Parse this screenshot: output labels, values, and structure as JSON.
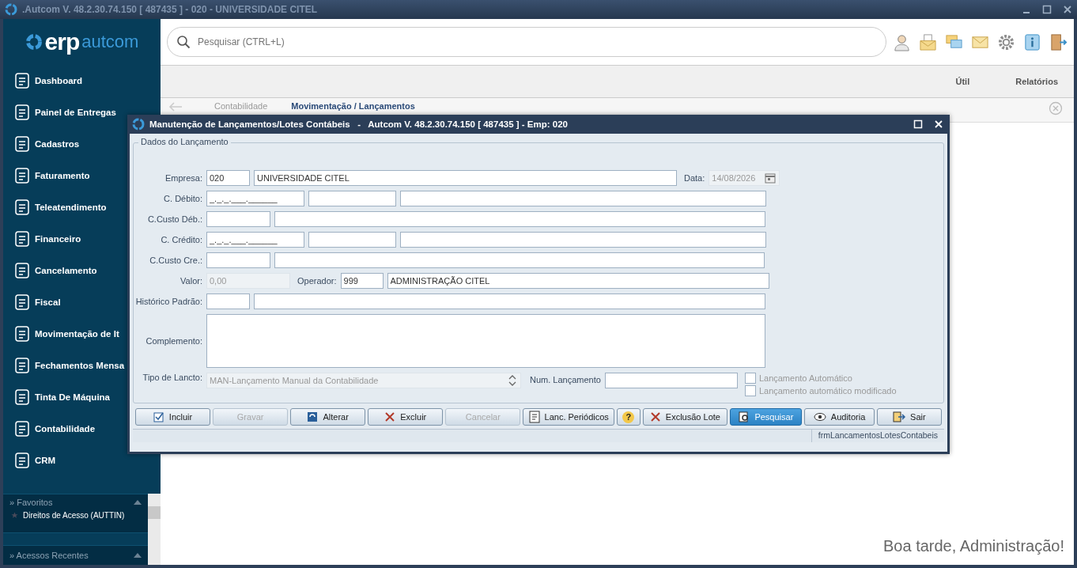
{
  "window": {
    "title": ".Autcom V. 48.2.30.74.150 [ 487435 ] - 020 - UNIVERSIDADE CITEL"
  },
  "sidebar": {
    "logo": {
      "brand": "erp",
      "product": "autcom"
    },
    "items": [
      {
        "label": "Dashboard"
      },
      {
        "label": "Painel de Entregas"
      },
      {
        "label": "Cadastros"
      },
      {
        "label": "Faturamento"
      },
      {
        "label": "Teleatendimento"
      },
      {
        "label": "Financeiro"
      },
      {
        "label": "Cancelamento"
      },
      {
        "label": "Fiscal"
      },
      {
        "label": "Movimentação de It"
      },
      {
        "label": "Fechamentos Mensa"
      },
      {
        "label": "Tinta De Máquina"
      },
      {
        "label": "Contabilidade"
      },
      {
        "label": "CRM"
      }
    ],
    "favorites": {
      "title": "» Favoritos",
      "items": [
        {
          "label": "Direitos de Acesso (AUTTIN)"
        }
      ]
    },
    "recent": {
      "title": "» Acessos Recentes"
    }
  },
  "search": {
    "placeholder": "Pesquisar (CTRL+L)"
  },
  "menu": [
    "Útil",
    "Relatórios"
  ],
  "breadcrumb": [
    "Contabilidade",
    "Movimentação / Lançamentos"
  ],
  "greeting": "Boa tarde, Administração!",
  "dialog": {
    "title": "Manutenção de Lançamentos/Lotes Contábeis   -   Autcom V. 48.2.30.74.150 [ 487435 ] - Emp: 020",
    "group_title": "Dados do Lançamento",
    "rows": [
      {
        "label": "Empresa:",
        "items": [
          {
            "kind": "input",
            "value": "020"
          },
          {
            "kind": "input",
            "value": "UNIVERSIDADE CITEL"
          },
          {
            "kind": "label",
            "text": "Data:"
          },
          {
            "kind": "date",
            "value": "14/08/2026",
            "disabled": true
          }
        ]
      },
      {
        "label": "C. Débito:",
        "items": [
          {
            "kind": "input",
            "value": "_._._.___.______"
          },
          {
            "kind": "input"
          },
          {
            "kind": "input"
          }
        ]
      },
      {
        "label": "C.Custo Déb.:",
        "items": [
          {
            "kind": "input"
          },
          {
            "kind": "input"
          }
        ]
      },
      {
        "label": "C. Crédito:",
        "items": [
          {
            "kind": "input",
            "value": "_._._.___.______"
          },
          {
            "kind": "input"
          },
          {
            "kind": "input"
          }
        ]
      },
      {
        "label": "C.Custo Cre.:",
        "items": [
          {
            "kind": "input"
          },
          {
            "kind": "input"
          }
        ]
      },
      {
        "label": "Valor:",
        "items": [
          {
            "kind": "input",
            "value": "0,00",
            "disabled": true
          },
          {
            "kind": "label",
            "text": "Operador:"
          },
          {
            "kind": "input",
            "value": "999"
          },
          {
            "kind": "input",
            "value": "ADMINISTRAÇÃO CITEL"
          }
        ]
      },
      {
        "label": "Histórico Padrão:",
        "items": [
          {
            "kind": "input"
          },
          {
            "kind": "input"
          }
        ]
      },
      {
        "label": "Complemento:",
        "items": [
          {
            "kind": "textarea"
          }
        ]
      }
    ],
    "tipo": {
      "label": "Tipo de Lancto:",
      "value": "MAN-Lançamento Manual da Contabilidade",
      "disabled": true
    },
    "num": {
      "label": "Num. Lançamento"
    },
    "checks": [
      {
        "label": "Lançamento Automático",
        "checked": false
      },
      {
        "label": "Lançamento automático modificado",
        "checked": false
      }
    ],
    "buttons": [
      {
        "label": "Incluir",
        "kind": "incluir",
        "disabled": false,
        "selected": false
      },
      {
        "label": "Gravar",
        "kind": "gravar",
        "disabled": true,
        "selected": false
      },
      {
        "label": "Alterar",
        "kind": "alterar",
        "disabled": false,
        "selected": false
      },
      {
        "label": "Excluir",
        "kind": "excluir",
        "disabled": false,
        "selected": false
      },
      {
        "label": "Cancelar",
        "kind": "cancelar",
        "disabled": true,
        "selected": false
      },
      {
        "label": "Lanc. Periódicos",
        "kind": "periodicos",
        "disabled": false,
        "selected": false
      },
      {
        "label": "?",
        "kind": "ajuda",
        "disabled": false,
        "selected": false
      },
      {
        "label": "Exclusão Lote",
        "kind": "excluir",
        "disabled": false,
        "selected": false
      },
      {
        "label": "Pesquisar",
        "kind": "pesquisar",
        "disabled": false,
        "selected": true
      },
      {
        "label": "Auditoria",
        "kind": "auditoria",
        "disabled": false,
        "selected": false
      },
      {
        "label": "Sair",
        "kind": "sair",
        "disabled": false,
        "selected": false
      }
    ],
    "status": "frmLancamentosLotesContabeis"
  }
}
